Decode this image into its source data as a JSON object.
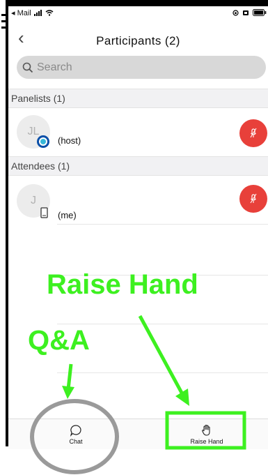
{
  "status_bar": {
    "carrier": "◂ Mail"
  },
  "nav": {
    "back_glyph": "‹",
    "title": "Participants (2)"
  },
  "search": {
    "placeholder": "Search"
  },
  "sections": {
    "panelists": {
      "label": "Panelists (1)"
    },
    "attendees": {
      "label": "Attendees (1)"
    }
  },
  "participants": [
    {
      "initials": "JL",
      "name": "(host)",
      "device": "host-badge-icon",
      "audio": "muted-mic-icon"
    },
    {
      "initials": "J",
      "name": "(me)",
      "device": "phone-icon",
      "audio": "muted-mic-icon"
    }
  ],
  "tabs": [
    {
      "label": "Chat",
      "icon": "chat-bubble-icon"
    },
    {
      "label": "Raise Hand",
      "icon": "raise-hand-icon"
    }
  ],
  "annotations": {
    "raise_hand": "Raise Hand",
    "qa": "Q&A"
  },
  "colors": {
    "mute_red": "#e8403a",
    "annotation_green": "#3df020",
    "circle_gray": "#9a9a9a",
    "search_bg": "#d8d8d8",
    "section_bg": "#f1f1f3"
  }
}
